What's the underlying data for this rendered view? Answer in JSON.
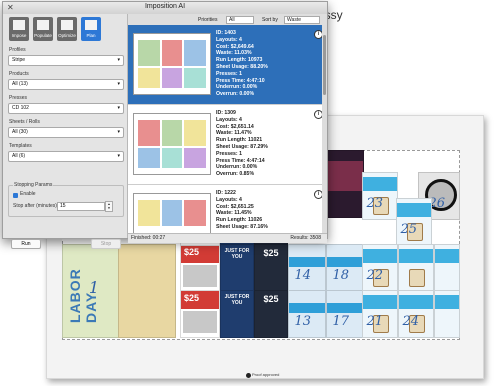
{
  "window": {
    "title": "Imposition AI"
  },
  "toolbar": {
    "buttons": [
      {
        "label": "Impose"
      },
      {
        "label": "Populate"
      },
      {
        "label": "Optimize"
      },
      {
        "label": "Plan"
      }
    ]
  },
  "fields": {
    "profiles": {
      "label": "Profiles",
      "value": "Stripe"
    },
    "products": {
      "label": "Products",
      "value": "All (13)"
    },
    "presses": {
      "label": "Presses",
      "value": "CD 102"
    },
    "sheets": {
      "label": "Sheets / Rolls",
      "value": "All (30)"
    },
    "templates": {
      "label": "Templates",
      "value": "All (6)"
    }
  },
  "stopping": {
    "group_label": "Stopping Params",
    "enable_label": "Enable",
    "stop_label": "Stop after (minutes)",
    "stop_value": "15"
  },
  "buttons": {
    "run": "Run",
    "stop": "Stop"
  },
  "filters": {
    "priorities_label": "Priorities",
    "priorities_value": "All",
    "sort_label": "Sort by",
    "sort_value": "Waste"
  },
  "results": [
    {
      "id": "ID: 1403",
      "layouts": "Layouts: 4",
      "cost": "Cost: $2,649.64",
      "waste": "Waste: 11.03%",
      "run_length": "Run Length: 10973",
      "sheet_usage": "Sheet Usage: 88.20%",
      "presses": "Presses: 1",
      "press_time": "Press Time: 4:47:10",
      "underrun": "Underrun: 0.00%",
      "overrun": "Overrun: 0.00%"
    },
    {
      "id": "ID: 1309",
      "layouts": "Layouts: 4",
      "cost": "Cost: $2,651.14",
      "waste": "Waste: 11.47%",
      "run_length": "Run Length: 11021",
      "sheet_usage": "Sheet Usage: 87.29%",
      "presses": "Presses: 1",
      "press_time": "Press Time: 4:47:14",
      "underrun": "Underrun: 0.00%",
      "overrun": "Overrun: 0.85%"
    },
    {
      "id": "ID: 1222",
      "layouts": "Layouts: 4",
      "cost": "Cost: $2,651.25",
      "waste": "Waste: 11.45%",
      "run_length": "Run Length: 11026",
      "sheet_usage": "Sheet Usage: 87.16%"
    }
  ],
  "status": {
    "finished": "Finished: 00:27",
    "results": "Results: 3508"
  },
  "background": {
    "glossy_text": "ossy",
    "approved_text": "Proof approved",
    "labor_day": "LABOR DAY",
    "card_numbers": [
      "1",
      "13",
      "14",
      "17",
      "18",
      "21",
      "22",
      "23",
      "24",
      "25",
      "26"
    ],
    "price_text": "$25",
    "just_for_you": "JUST FOR YOU"
  },
  "colors": {
    "accent": "#2d78d6",
    "selected_row": "#2d6fb9",
    "coupon_red": "#d23b35",
    "coupon_blue": "#3fb0e0"
  }
}
